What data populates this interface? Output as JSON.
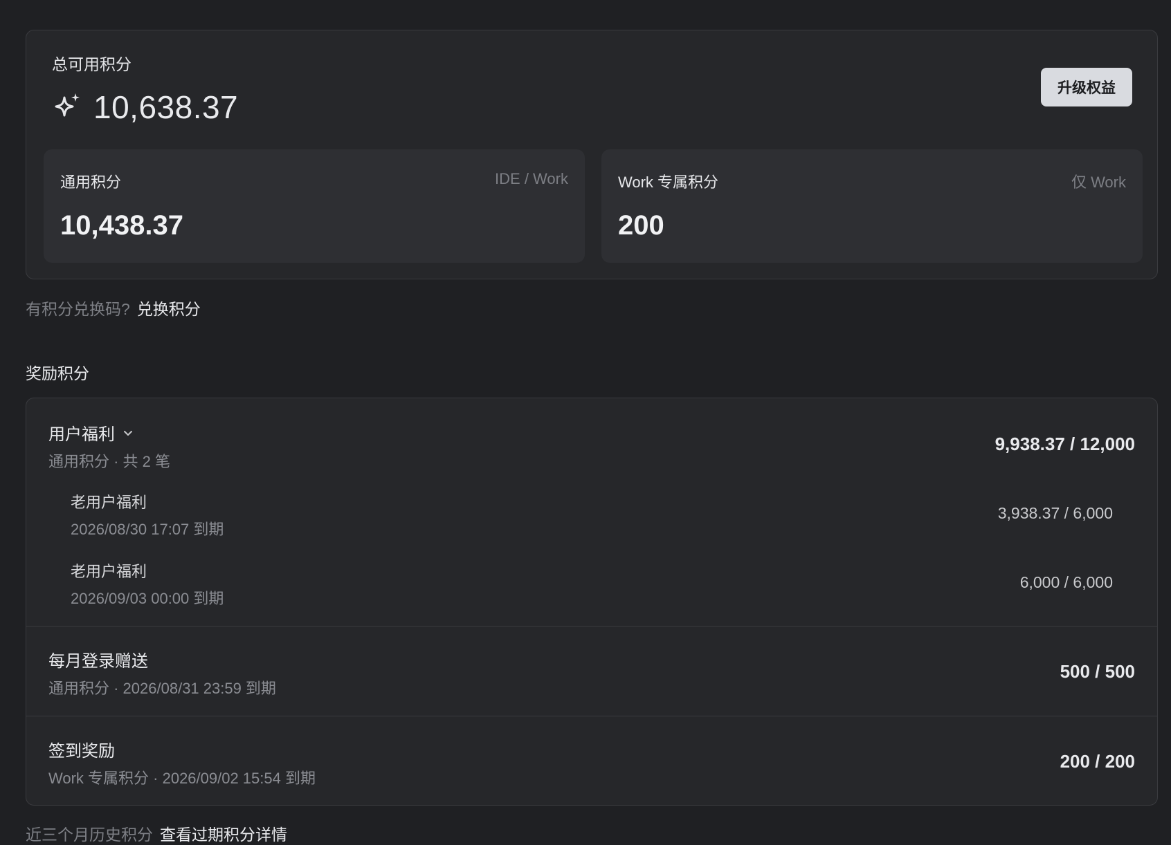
{
  "summary": {
    "total_label": "总可用积分",
    "total_icon": "sparkle-icon",
    "total_value": "10,638.37",
    "upgrade_label": "升级权益",
    "general": {
      "title": "通用积分",
      "scope": "IDE / Work",
      "value": "10,438.37"
    },
    "work": {
      "title": "Work 专属积分",
      "scope": "仅 Work",
      "value": "200"
    }
  },
  "redeem": {
    "prompt": "有积分兑换码?",
    "link": "兑换积分"
  },
  "rewards": {
    "section_title": "奖励积分",
    "benefit": {
      "title": "用户福利",
      "subtitle": "通用积分 · 共 2 笔",
      "amount": "9,938.37 / 12,000",
      "items": [
        {
          "title": "老用户福利",
          "expiry": "2026/08/30 17:07 到期",
          "amount": "3,938.37 / 6,000"
        },
        {
          "title": "老用户福利",
          "expiry": "2026/09/03 00:00 到期",
          "amount": "6,000 / 6,000"
        }
      ]
    },
    "monthly": {
      "title": "每月登录赠送",
      "subtitle": "通用积分 · 2026/08/31 23:59 到期",
      "amount": "500 / 500"
    },
    "checkin": {
      "title": "签到奖励",
      "subtitle": "Work 专属积分 · 2026/09/02 15:54 到期",
      "amount": "200 / 200"
    }
  },
  "history": {
    "prompt": "近三个月历史积分",
    "link": "查看过期积分详情"
  },
  "colors": {
    "background": "#1f2023",
    "card": "#26272a",
    "subcard": "#2e2f33",
    "button": "#d9dbe0",
    "muted": "#7d7f85"
  }
}
